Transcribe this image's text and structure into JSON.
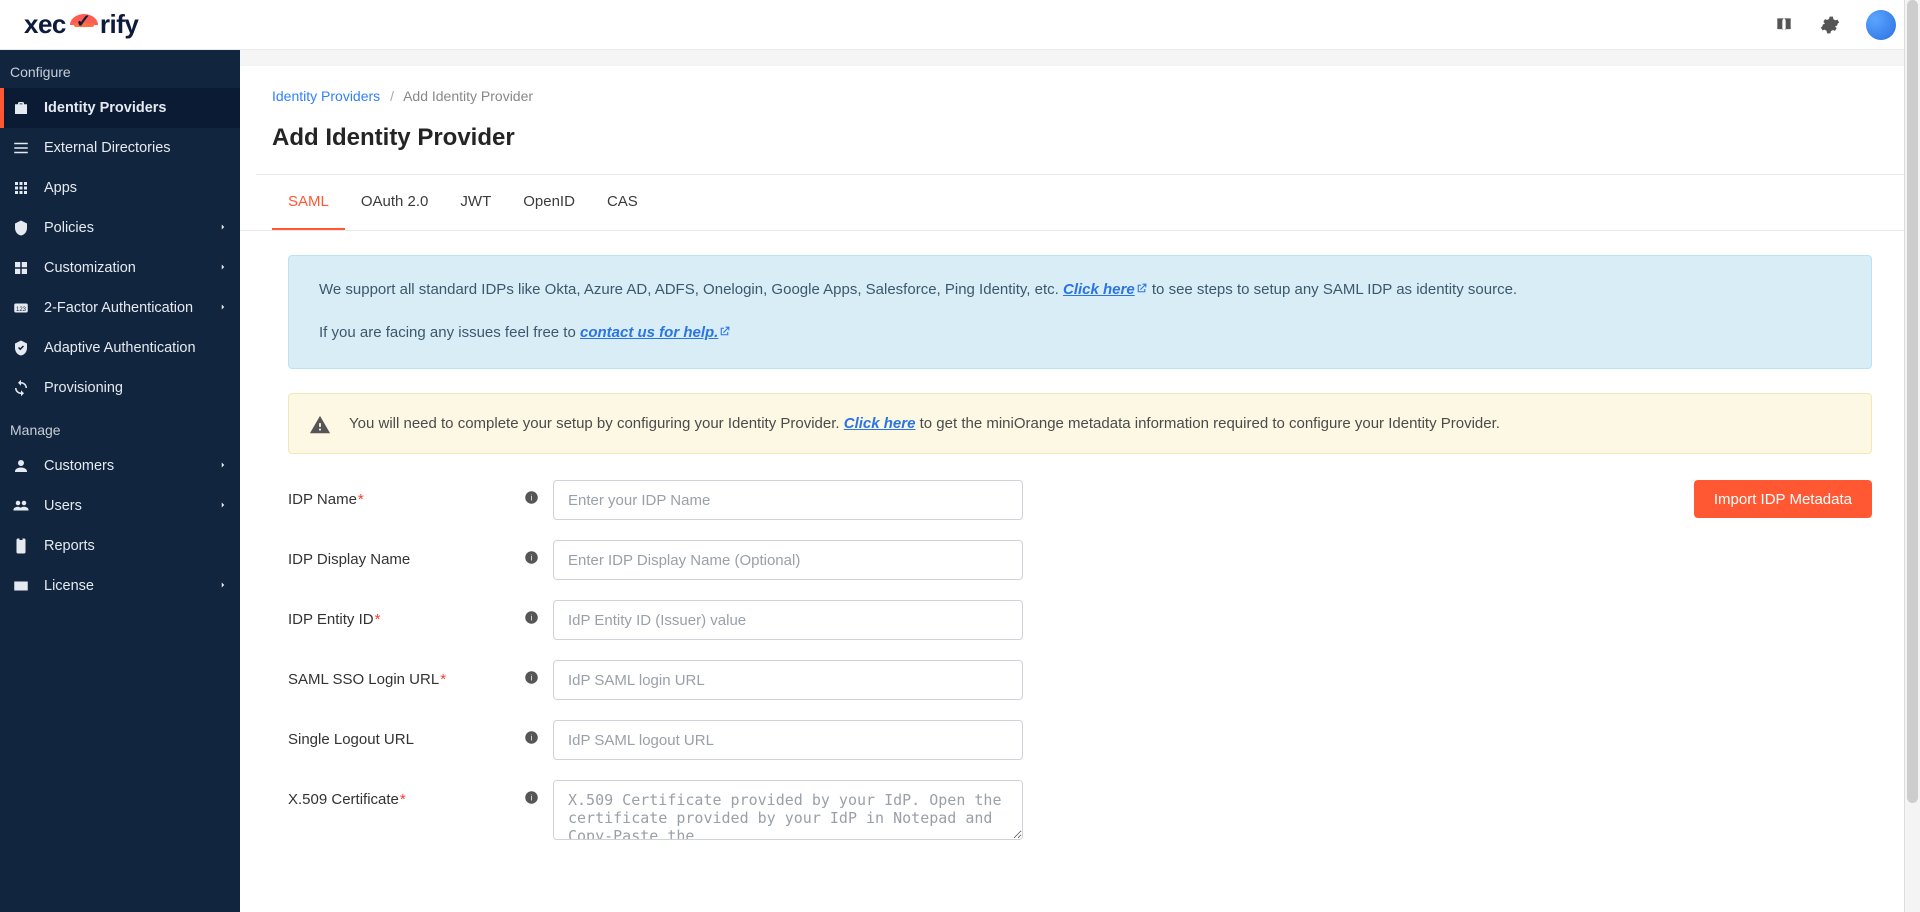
{
  "logo_text_left": "xec",
  "logo_text_right": "rify",
  "sidebar": {
    "section_configure": "Configure",
    "section_manage": "Manage",
    "items_configure": [
      {
        "label": "Identity Providers",
        "icon": "kit",
        "active": true
      },
      {
        "label": "External Directories",
        "icon": "list"
      },
      {
        "label": "Apps",
        "icon": "grid"
      },
      {
        "label": "Policies",
        "icon": "shield",
        "chev": true
      },
      {
        "label": "Customization",
        "icon": "squares",
        "chev": true
      },
      {
        "label": "2-Factor Authentication",
        "icon": "num",
        "chev": true
      },
      {
        "label": "Adaptive Authentication",
        "icon": "shieldok"
      },
      {
        "label": "Provisioning",
        "icon": "sync"
      }
    ],
    "items_manage": [
      {
        "label": "Customers",
        "icon": "person",
        "chev": true
      },
      {
        "label": "Users",
        "icon": "people",
        "chev": true
      },
      {
        "label": "Reports",
        "icon": "clip"
      },
      {
        "label": "License",
        "icon": "card",
        "chev": true
      }
    ]
  },
  "breadcrumbs": {
    "root": "Identity Providers",
    "current": "Add Identity Provider"
  },
  "page_title": "Add Identity Provider",
  "tabs": [
    "SAML",
    "OAuth 2.0",
    "JWT",
    "OpenID",
    "CAS"
  ],
  "active_tab": "SAML",
  "infobox": {
    "line1_a": "We support all standard IDPs like Okta, Azure AD, ADFS, Onelogin, Google Apps, Salesforce, Ping Identity, etc. ",
    "click_here": "Click here",
    "line1_b": " to see steps to setup any SAML IDP as identity source.",
    "line2_a": "If you are facing any issues feel free to ",
    "contact": "contact us for help."
  },
  "warnbox": {
    "a": "You will need to complete your setup by configuring your Identity Provider. ",
    "link": "Click here",
    "b": " to get the miniOrange metadata information required to configure your Identity Provider."
  },
  "form": {
    "import_btn": "Import IDP Metadata",
    "fields": [
      {
        "label": "IDP Name",
        "required": true,
        "placeholder": "Enter your IDP Name"
      },
      {
        "label": "IDP Display Name",
        "required": false,
        "placeholder": "Enter IDP Display Name (Optional)"
      },
      {
        "label": "IDP Entity ID",
        "required": true,
        "placeholder": "IdP Entity ID (Issuer) value"
      },
      {
        "label": "SAML SSO Login URL",
        "required": true,
        "placeholder": "IdP SAML login URL"
      },
      {
        "label": "Single Logout URL",
        "required": false,
        "placeholder": "IdP SAML logout URL"
      },
      {
        "label": "X.509 Certificate",
        "required": true,
        "placeholder": "X.509 Certificate provided by your IdP. Open the certificate provided by your IdP in Notepad and Copy-Paste the",
        "textarea": true
      }
    ]
  }
}
